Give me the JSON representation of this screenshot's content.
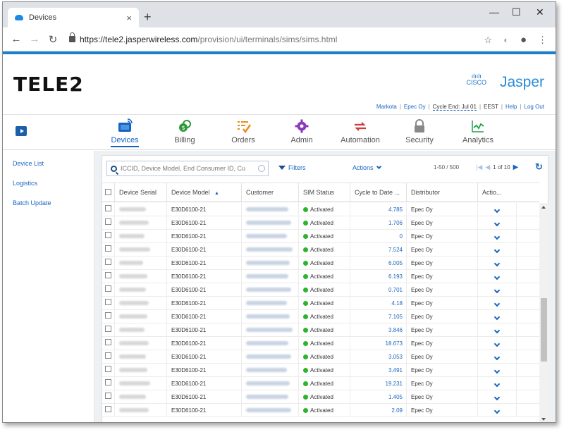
{
  "browser": {
    "tab_title": "Devices",
    "tab_close": "×",
    "new_tab": "+",
    "url_host": "https://tele2.jasperwireless.com",
    "url_path": "/provision/ui/terminals/sims/sims.html",
    "minimize": "—",
    "maximize": "☐",
    "close": "✕"
  },
  "header": {
    "brand": "TELE2",
    "cisco_bars": "ılıılı",
    "cisco": "CISCO",
    "jasper": "Jasper",
    "user": "Markota",
    "org": "Epec Oy",
    "cycle_end": "Cycle End: Jul 01",
    "timezone": "EEST",
    "help": "Help",
    "logout": "Log Out",
    "sep": "|"
  },
  "nav": {
    "items": [
      {
        "label": "Devices",
        "icon": "devices-icon",
        "color": "#1565c0"
      },
      {
        "label": "Billing",
        "icon": "billing-icon",
        "color": "#2e9a3a"
      },
      {
        "label": "Orders",
        "icon": "orders-icon",
        "color": "#f08a1c"
      },
      {
        "label": "Admin",
        "icon": "admin-gear-icon",
        "color": "#8a3ab9"
      },
      {
        "label": "Automation",
        "icon": "automation-icon",
        "color": "#d23b3b"
      },
      {
        "label": "Security",
        "icon": "lock-icon",
        "color": "#888888"
      },
      {
        "label": "Analytics",
        "icon": "analytics-icon",
        "color": "#22a04a"
      }
    ]
  },
  "sidebar": {
    "items": [
      {
        "label": "Device List"
      },
      {
        "label": "Logistics"
      },
      {
        "label": "Batch Update"
      }
    ]
  },
  "toolbar": {
    "search_placeholder": "ICCID, Device Model, End Consumer ID, Cu",
    "filters": "Filters",
    "actions": "Actions",
    "page_count": "1-50 / 500",
    "page_of": "1 of 10"
  },
  "table": {
    "headers": [
      "Device Serial",
      "Device Model",
      "Customer",
      "SIM Status",
      "Cycle to Date ...",
      "Distributor",
      "Actio..."
    ],
    "rows": [
      {
        "model": "E30D6100-21",
        "status": "Activated",
        "usage": "4.785",
        "distributor": "Epec Oy"
      },
      {
        "model": "E30D6100-21",
        "status": "Activated",
        "usage": "1.706",
        "distributor": "Epec Oy"
      },
      {
        "model": "E30D6100-21",
        "status": "Activated",
        "usage": "0",
        "distributor": "Epec Oy"
      },
      {
        "model": "E30D6100-21",
        "status": "Activated",
        "usage": "7.524",
        "distributor": "Epec Oy"
      },
      {
        "model": "E30D6100-21",
        "status": "Activated",
        "usage": "6.005",
        "distributor": "Epec Oy"
      },
      {
        "model": "E30D6100-21",
        "status": "Activated",
        "usage": "6.193",
        "distributor": "Epec Oy"
      },
      {
        "model": "E30D6100-21",
        "status": "Activated",
        "usage": "0.701",
        "distributor": "Epec Oy"
      },
      {
        "model": "E30D6100-21",
        "status": "Activated",
        "usage": "4.18",
        "distributor": "Epec Oy"
      },
      {
        "model": "E30D6100-21",
        "status": "Activated",
        "usage": "7.105",
        "distributor": "Epec Oy"
      },
      {
        "model": "E30D6100-21",
        "status": "Activated",
        "usage": "3.846",
        "distributor": "Epec Oy"
      },
      {
        "model": "E30D6100-21",
        "status": "Activated",
        "usage": "18.673",
        "distributor": "Epec Oy"
      },
      {
        "model": "E30D6100-21",
        "status": "Activated",
        "usage": "3.053",
        "distributor": "Epec Oy"
      },
      {
        "model": "E30D6100-21",
        "status": "Activated",
        "usage": "3.491",
        "distributor": "Epec Oy"
      },
      {
        "model": "E30D6100-21",
        "status": "Activated",
        "usage": "19.231",
        "distributor": "Epec Oy"
      },
      {
        "model": "E30D6100-21",
        "status": "Activated",
        "usage": "1.405",
        "distributor": "Epec Oy"
      },
      {
        "model": "E30D6100-21",
        "status": "Activated",
        "usage": "2.09",
        "distributor": "Epec Oy"
      }
    ]
  }
}
